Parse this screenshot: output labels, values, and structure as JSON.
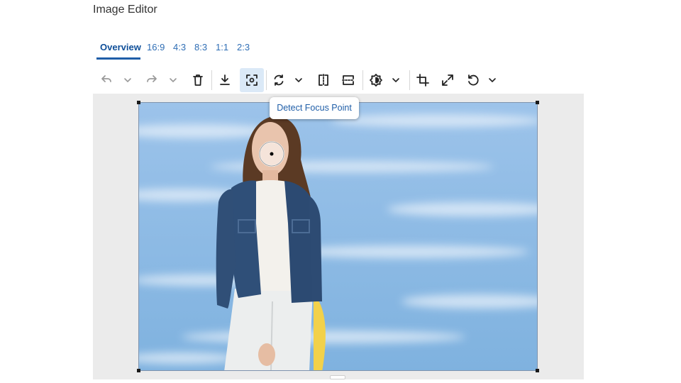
{
  "app": {
    "title": "Image Editor"
  },
  "tabs": [
    {
      "label": "Overview",
      "active": true
    },
    {
      "label": "16:9"
    },
    {
      "label": "4:3"
    },
    {
      "label": "8:3"
    },
    {
      "label": "1:1"
    },
    {
      "label": "2:3"
    }
  ],
  "toolbar": {
    "icons": [
      "undo-icon",
      "chevron-down-icon",
      "redo-icon",
      "chevron-down-icon",
      "trash-icon",
      "download-icon",
      "focus-point-icon",
      "rotate-icon",
      "chevron-down-icon",
      "flip-horizontal-icon",
      "flip-vertical-icon",
      "brightness-icon",
      "chevron-down-icon",
      "crop-icon",
      "expand-icon",
      "reset-icon",
      "chevron-down-icon"
    ],
    "active_tool": "focus-point-icon",
    "tooltip": "Detect Focus Point"
  },
  "colors": {
    "accent": "#1f5ea8",
    "tab_text": "#2f6eb5",
    "canvas_bg": "#ebebeb",
    "active_tool_bg": "#dbe9f7",
    "sky": "#8dbbe4",
    "jacket": "#2f4f78"
  }
}
